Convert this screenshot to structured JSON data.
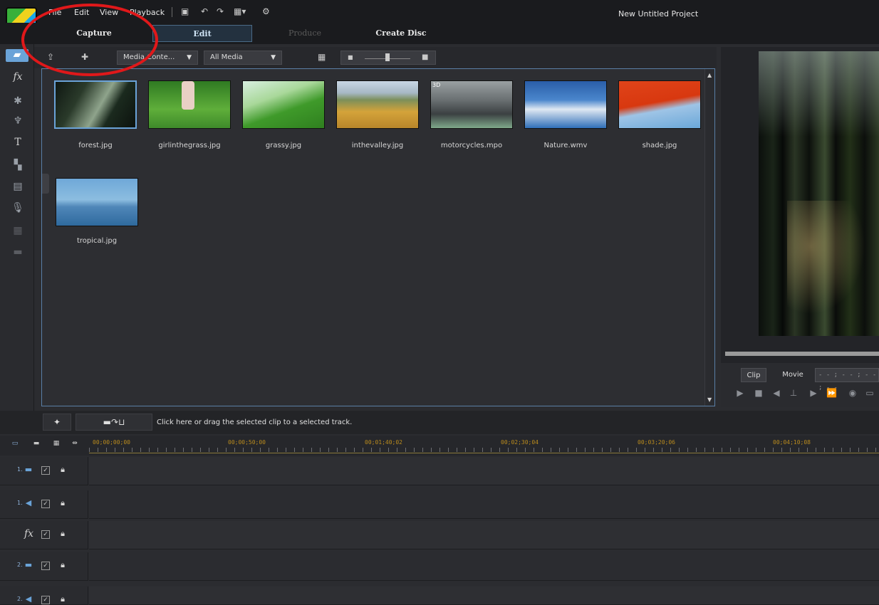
{
  "app": {
    "project_title": "New Untitled Project",
    "menu": [
      "File",
      "Edit",
      "View",
      "Playback"
    ]
  },
  "mode_tabs": [
    "Capture",
    "Edit",
    "Produce",
    "Create Disc"
  ],
  "media_toolbar": {
    "content_dropdown": "Media Conte...",
    "filter_dropdown": "All Media"
  },
  "library": {
    "items": [
      {
        "name": "forest.jpg"
      },
      {
        "name": "girlinthegrass.jpg"
      },
      {
        "name": "grassy.jpg"
      },
      {
        "name": "inthevalley.jpg"
      },
      {
        "name": "motorcycles.mpo",
        "badge": "3D"
      },
      {
        "name": "Nature.wmv"
      },
      {
        "name": "shade.jpg"
      },
      {
        "name": "tropical.jpg"
      }
    ]
  },
  "preview": {
    "clip_tab": "Clip",
    "movie_tab": "Movie",
    "timecode": "- - ; - - ; - - ; - -"
  },
  "action_bar": {
    "hint": "Click here or drag the selected clip to a selected track."
  },
  "timeline": {
    "timecodes": [
      "00;00;00;00",
      "00;00;50;00",
      "00;01;40;02",
      "00;02;30;04",
      "00;03;20;06",
      "00;04;10;08"
    ],
    "tracks": [
      {
        "number": "1.",
        "type": "video"
      },
      {
        "number": "1.",
        "type": "audio"
      },
      {
        "number": "",
        "type": "fx"
      },
      {
        "number": "2.",
        "type": "video"
      },
      {
        "number": "2.",
        "type": "audio"
      }
    ]
  },
  "icons": {
    "fx_label": "fx",
    "title_label": "T"
  },
  "colors": {
    "accent": "#6aa3d8",
    "annotation": "#e0181a",
    "timecode": "#b98a1d"
  }
}
